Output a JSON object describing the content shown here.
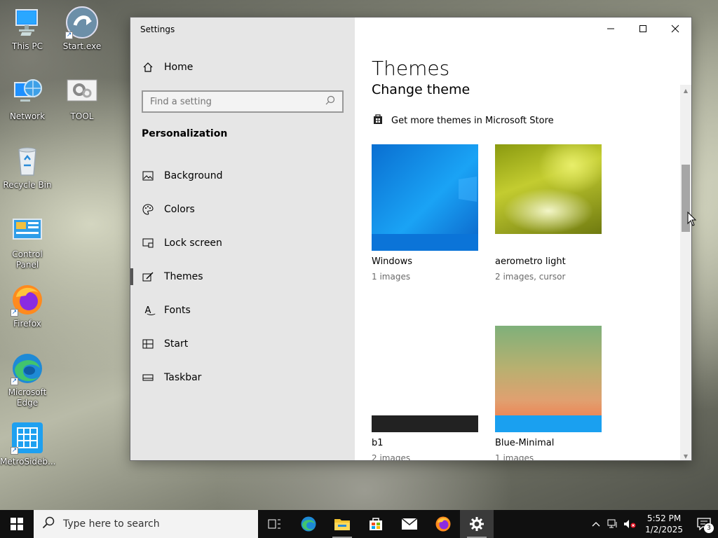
{
  "desktop": {
    "icons": [
      {
        "label": "This PC"
      },
      {
        "label": "Start.exe"
      },
      {
        "label": "Network"
      },
      {
        "label": "TOOL"
      },
      {
        "label": "Recycle Bin"
      },
      {
        "label": "Control Panel"
      },
      {
        "label": "Firefox"
      },
      {
        "label": "Microsoft Edge"
      },
      {
        "label": "MetroSideb..."
      }
    ]
  },
  "window": {
    "title": "Settings",
    "controls": {
      "minimize": "─",
      "maximize": "☐",
      "close": "✕"
    }
  },
  "sidebar": {
    "home_label": "Home",
    "search_placeholder": "Find a setting",
    "section_title": "Personalization",
    "items": [
      {
        "label": "Background",
        "icon": "image-icon"
      },
      {
        "label": "Colors",
        "icon": "palette-icon"
      },
      {
        "label": "Lock screen",
        "icon": "lock-screen-icon"
      },
      {
        "label": "Themes",
        "icon": "brush-icon",
        "active": true
      },
      {
        "label": "Fonts",
        "icon": "font-icon"
      },
      {
        "label": "Start",
        "icon": "start-icon"
      },
      {
        "label": "Taskbar",
        "icon": "taskbar-icon"
      }
    ]
  },
  "main": {
    "page_title": "Themes",
    "sub_title": "Change theme",
    "store_link": "Get more themes in Microsoft Store",
    "themes": [
      {
        "name": "Windows",
        "meta": "1 images"
      },
      {
        "name": "aerometro light",
        "meta": "2 images, cursor"
      },
      {
        "name": "b1",
        "meta": "2 images"
      },
      {
        "name": "Blue-Minimal",
        "meta": "1 images"
      }
    ]
  },
  "taskbar": {
    "search_placeholder": "Type here to search",
    "time": "5:52 PM",
    "date": "1/2/2025",
    "notification_count": "3"
  },
  "colors": {
    "accent": "#0078d7",
    "taskbar": "#101010",
    "sidebar_bg": "#e6e6e6"
  }
}
